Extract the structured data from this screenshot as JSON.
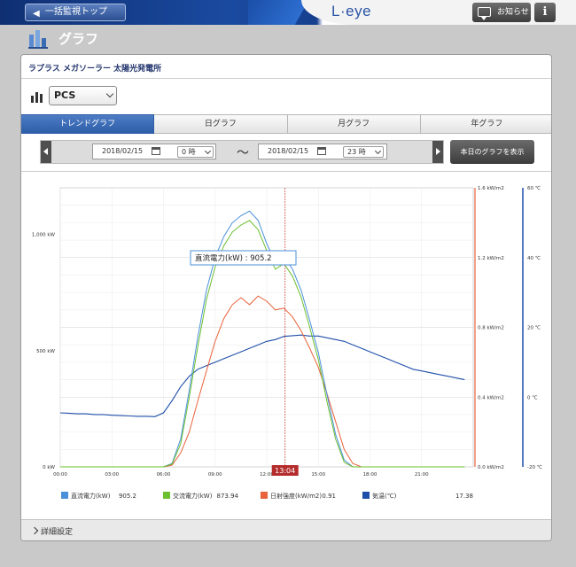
{
  "header": {
    "back_label": "一括監視トップ",
    "logo": "L·eye",
    "notice_label": "お知らせ",
    "info_label": "i"
  },
  "page": {
    "title": "グラフ"
  },
  "panel": {
    "title": "ラプラス メガソーラー 太陽光発電所",
    "selector_value": "PCS"
  },
  "tabs": [
    "トレンドグラフ",
    "日グラフ",
    "月グラフ",
    "年グラフ"
  ],
  "active_tab": 0,
  "date_range": {
    "from_date": "2018/02/15",
    "from_hour": "0 時",
    "separator": "〜",
    "to_date": "2018/02/15",
    "to_hour": "23 時"
  },
  "today_button": "本日のグラフを表示",
  "details_label": "詳細設定",
  "colors": {
    "dc_power": "#4a90d9",
    "ac_power": "#6cbf2e",
    "irradiance": "#e8623a",
    "temperature": "#1f4ea8",
    "cursor": "#c83a3a"
  },
  "chart_data": {
    "type": "line",
    "x": [
      "00:00",
      "00:30",
      "01:00",
      "01:30",
      "02:00",
      "02:30",
      "03:00",
      "03:30",
      "04:00",
      "04:30",
      "05:00",
      "05:30",
      "06:00",
      "06:30",
      "07:00",
      "07:30",
      "08:00",
      "08:30",
      "09:00",
      "09:30",
      "10:00",
      "10:30",
      "11:00",
      "11:30",
      "12:00",
      "12:30",
      "13:00",
      "13:30",
      "14:00",
      "14:30",
      "15:00",
      "15:30",
      "16:00",
      "16:30",
      "17:00",
      "17:30",
      "18:00",
      "18:30",
      "19:00",
      "19:30",
      "20:00",
      "20:30",
      "21:00",
      "21:30",
      "22:00",
      "22:30",
      "23:00",
      "23:30"
    ],
    "x_ticks": [
      "00:00",
      "03:00",
      "06:00",
      "09:00",
      "12:00",
      "15:00",
      "18:00",
      "21:00"
    ],
    "cursor": {
      "label": "13:04",
      "x": "13:04"
    },
    "tooltip": "直流電力(kW) : 905.2",
    "axes": {
      "left": {
        "ticks": [
          "0 kW",
          "500 kW",
          "1,000 kW"
        ],
        "range": [
          0,
          1200
        ]
      },
      "right1": {
        "ticks": [
          "0.0 kW/m2",
          "0.4 kW/m2",
          "0.8 kW/m2",
          "1.2 kW/m2",
          "1.6 kW/m2"
        ],
        "range": [
          0,
          1.6
        ]
      },
      "right2": {
        "ticks": [
          "-20 ℃",
          "0 ℃",
          "20 ℃",
          "40 ℃",
          "60 ℃"
        ],
        "range": [
          -20,
          60
        ]
      }
    },
    "series": [
      {
        "name": "直流電力(kW)",
        "legend_value": "905.2",
        "axis": "left",
        "values": [
          0,
          0,
          0,
          0,
          0,
          0,
          0,
          0,
          0,
          0,
          0,
          0,
          0,
          15,
          120,
          330,
          560,
          760,
          900,
          990,
          1050,
          1080,
          1100,
          1060,
          960,
          880,
          905,
          850,
          760,
          630,
          490,
          310,
          140,
          30,
          0,
          0,
          0,
          0,
          0,
          0,
          0,
          0,
          0,
          0,
          0,
          0,
          0,
          0
        ]
      },
      {
        "name": "交流電力(kW)",
        "legend_value": "873.94",
        "axis": "left",
        "values": [
          0,
          0,
          0,
          0,
          0,
          0,
          0,
          0,
          0,
          0,
          0,
          0,
          0,
          12,
          100,
          300,
          520,
          720,
          860,
          950,
          1010,
          1040,
          1060,
          1020,
          930,
          850,
          874,
          820,
          730,
          600,
          460,
          280,
          120,
          20,
          0,
          0,
          0,
          0,
          0,
          0,
          0,
          0,
          0,
          0,
          0,
          0,
          0,
          0
        ]
      },
      {
        "name": "日射強度(kW/m2)",
        "legend_value": "0.91",
        "axis": "right1",
        "values": [
          0,
          0,
          0,
          0,
          0,
          0,
          0,
          0,
          0,
          0,
          0,
          0,
          0,
          0.01,
          0.08,
          0.2,
          0.38,
          0.55,
          0.72,
          0.85,
          0.93,
          0.97,
          0.93,
          0.98,
          0.95,
          0.9,
          0.91,
          0.86,
          0.78,
          0.68,
          0.57,
          0.42,
          0.26,
          0.1,
          0.02,
          0,
          0,
          0,
          0,
          0,
          0,
          0,
          0,
          0,
          0,
          0,
          0,
          0
        ]
      },
      {
        "name": "気温(℃)",
        "legend_value": "17.38",
        "axis": "right2",
        "values": [
          -4.5,
          -4.6,
          -4.8,
          -4.8,
          -5,
          -5,
          -5.2,
          -5.3,
          -5.4,
          -5.5,
          -5.5,
          -5.6,
          -4.5,
          -1,
          3,
          6,
          8,
          9,
          10,
          11,
          12,
          13,
          14,
          15,
          16,
          16.5,
          17.4,
          17.6,
          17.8,
          17.5,
          17.5,
          17,
          16.5,
          16,
          15,
          14,
          13,
          12,
          11,
          10,
          9,
          8,
          7.5,
          7,
          6.5,
          6,
          5.5,
          5
        ]
      }
    ]
  }
}
